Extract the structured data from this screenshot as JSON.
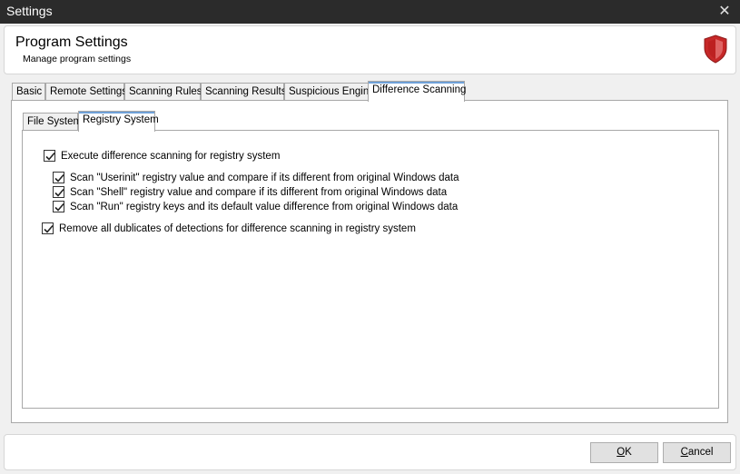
{
  "window": {
    "title": "Settings"
  },
  "header": {
    "title": "Program Settings",
    "subtitle": "Manage program settings"
  },
  "tabs": [
    {
      "label": "Basic"
    },
    {
      "label": "Remote Settings"
    },
    {
      "label": "Scanning Rules"
    },
    {
      "label": "Scanning Results"
    },
    {
      "label": "Suspicious Engine"
    },
    {
      "label": "Difference Scanning",
      "active": true
    }
  ],
  "subtabs": [
    {
      "label": "File System"
    },
    {
      "label": "Registry System",
      "active": true
    }
  ],
  "options": {
    "execute": {
      "label": "Execute difference scanning for registry system",
      "checked": true
    },
    "userinit": {
      "label": "Scan \"Userinit\" registry value and compare if its different from original Windows data",
      "checked": true
    },
    "shell": {
      "label": "Scan \"Shell\" registry value and compare if its different from original Windows data",
      "checked": true
    },
    "run": {
      "label": "Scan \"Run\" registry keys and its default value difference from original Windows data",
      "checked": true
    },
    "dublicates": {
      "label": "Remove all dublicates of detections for difference scanning in registry system",
      "checked": true
    }
  },
  "buttons": {
    "ok": {
      "mnemonic": "O",
      "rest": "K"
    },
    "cancel": {
      "mnemonic": "C",
      "rest": "ancel"
    }
  },
  "colors": {
    "titlebar": "#2b2b2b",
    "accent_tab": "#6fa1d8",
    "shield": "#c62828"
  }
}
